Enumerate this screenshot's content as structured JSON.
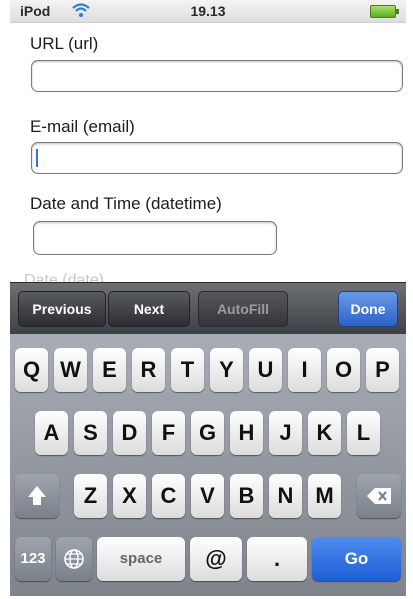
{
  "status_bar": {
    "carrier": "iPod",
    "time": "19.13"
  },
  "form": {
    "fields": [
      {
        "label": "URL (url)",
        "value": ""
      },
      {
        "label": "E-mail (email)",
        "value": ""
      },
      {
        "label": "Date and Time (datetime)",
        "value": ""
      }
    ],
    "partially_hidden_label": "Date (date)"
  },
  "accessory": {
    "previous": "Previous",
    "next": "Next",
    "autofill": "AutoFill",
    "done": "Done"
  },
  "keyboard": {
    "row1": [
      "Q",
      "W",
      "E",
      "R",
      "T",
      "Y",
      "U",
      "I",
      "O",
      "P"
    ],
    "row2": [
      "A",
      "S",
      "D",
      "F",
      "G",
      "H",
      "J",
      "K",
      "L"
    ],
    "row3": [
      "Z",
      "X",
      "C",
      "V",
      "B",
      "N",
      "M"
    ],
    "numbers_key": "123",
    "space_key": "space",
    "at_key": "@",
    "dot_key": ".",
    "go_key": "Go",
    "icons": {
      "shift": "shift-arrow-icon",
      "delete": "backspace-icon",
      "globe": "globe-icon"
    }
  }
}
